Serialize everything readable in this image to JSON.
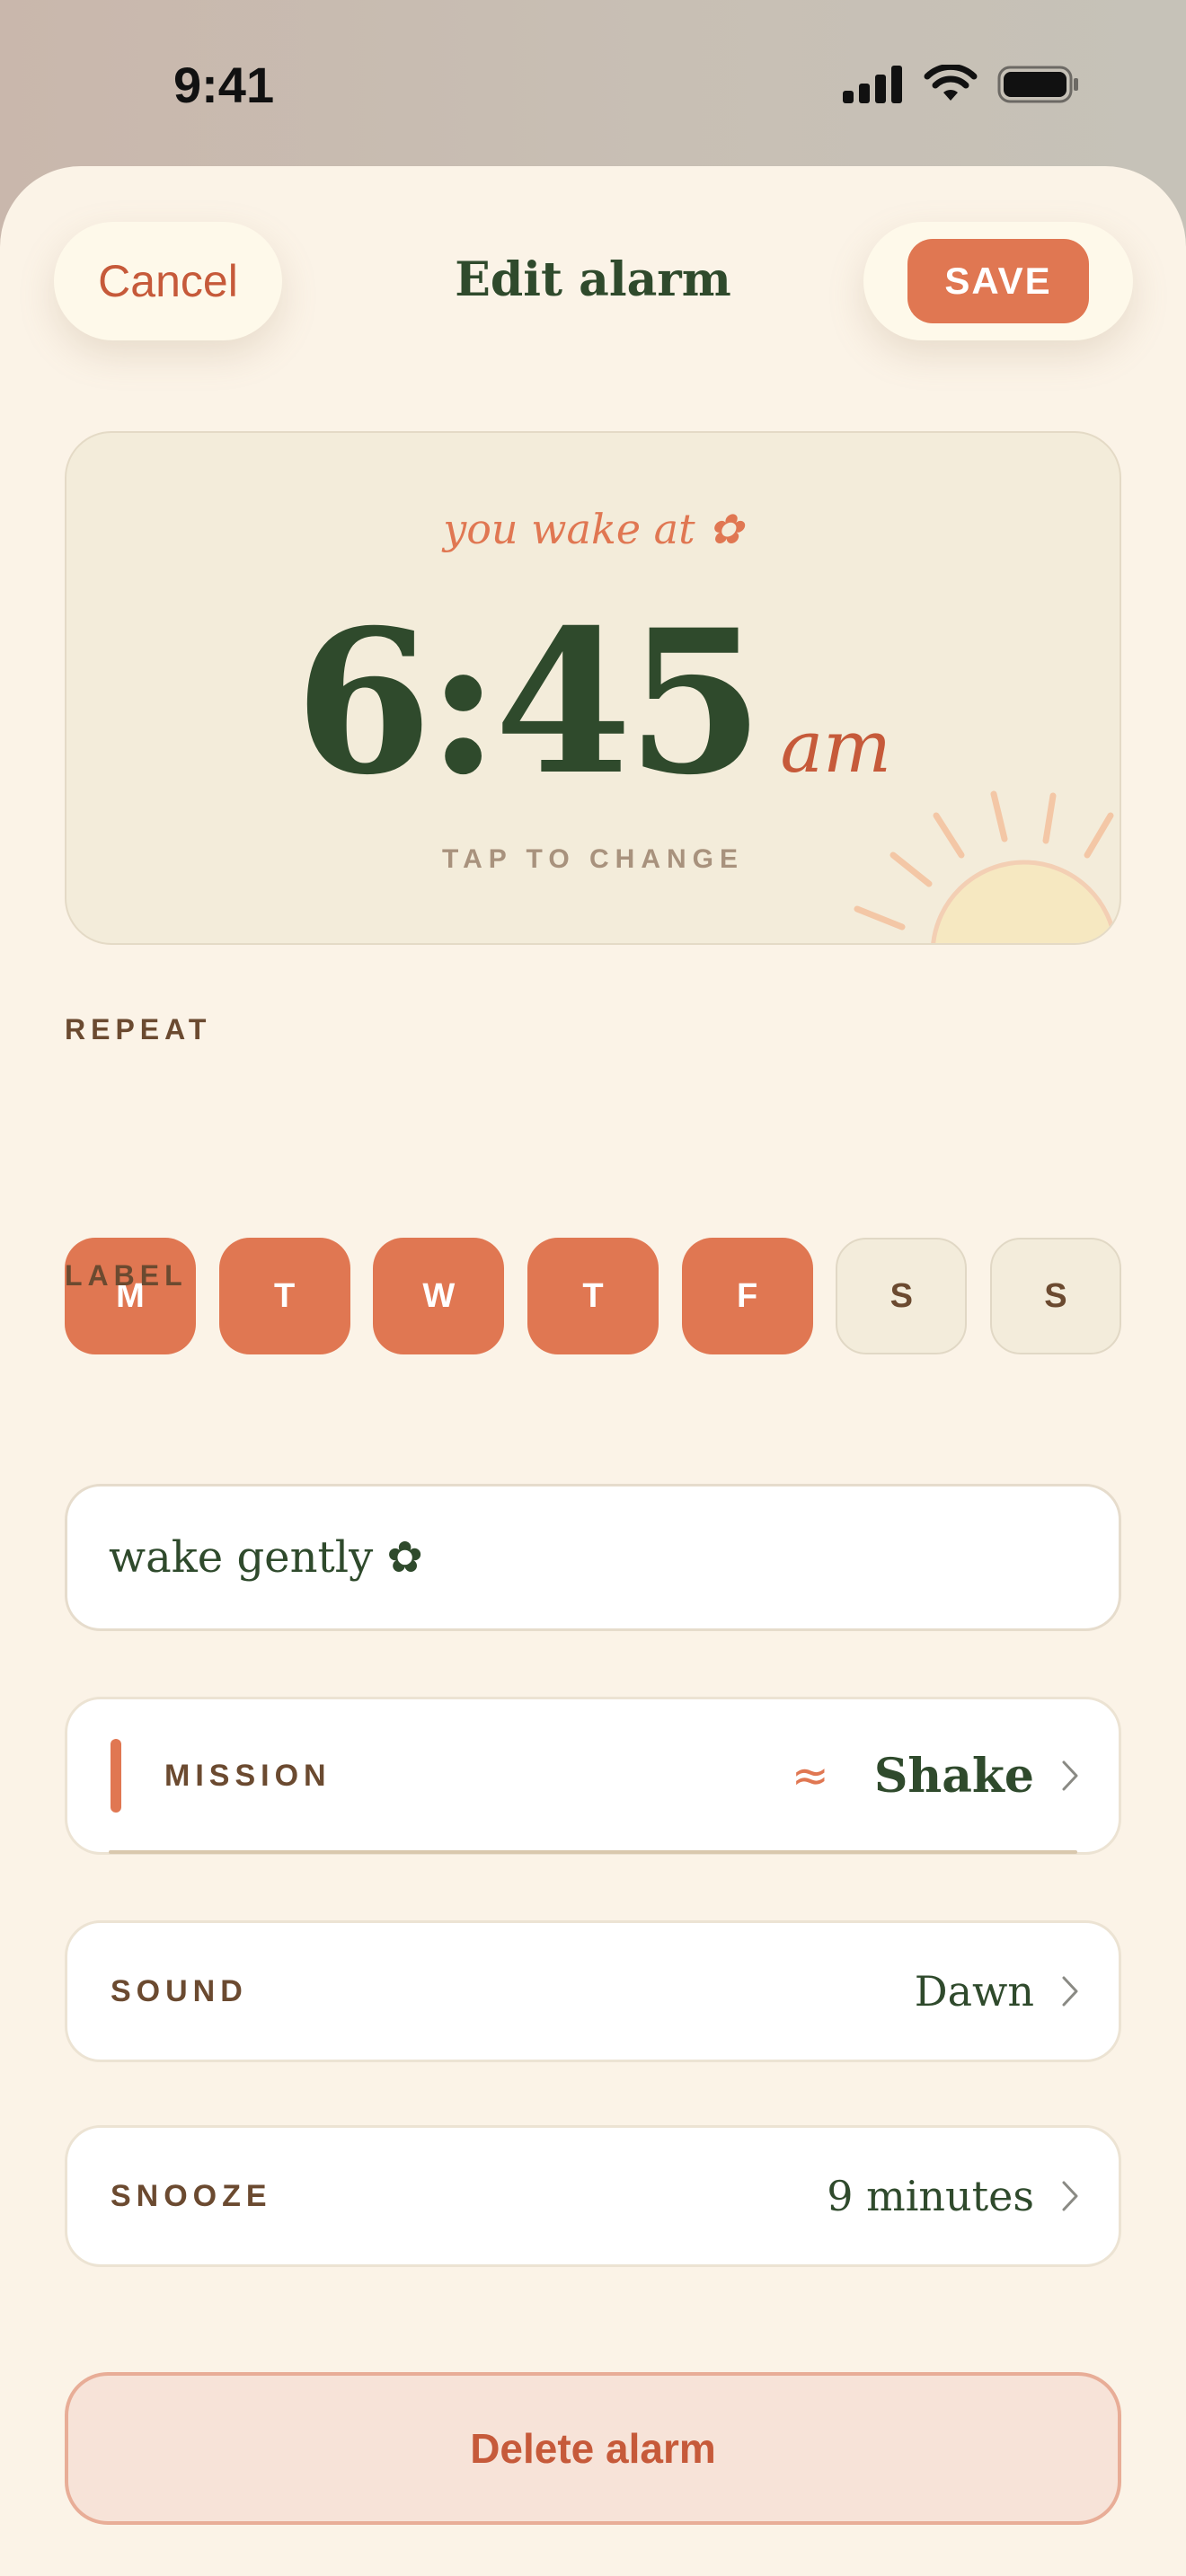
{
  "status_bar": {
    "time": "9:41",
    "icons": [
      "cellular-signal-icon",
      "wifi-icon",
      "battery-icon"
    ]
  },
  "nav": {
    "cancel_label": "Cancel",
    "title": "Edit alarm",
    "save_label": "SAVE"
  },
  "time_card": {
    "caption": "you wake at ✿",
    "time": "6:45",
    "ampm": "am",
    "hint": "TAP TO CHANGE",
    "decoration": "sun-icon"
  },
  "repeat": {
    "label": "REPEAT",
    "days": [
      {
        "letter": "M",
        "selected": true
      },
      {
        "letter": "T",
        "selected": true
      },
      {
        "letter": "W",
        "selected": true
      },
      {
        "letter": "T",
        "selected": true
      },
      {
        "letter": "F",
        "selected": true
      },
      {
        "letter": "S",
        "selected": false
      },
      {
        "letter": "S",
        "selected": false
      }
    ]
  },
  "label_field": {
    "label": "LABEL",
    "value": "wake gently ✿"
  },
  "mission": {
    "label": "MISSION",
    "icon_glyph": "≈",
    "value": "Shake"
  },
  "sound": {
    "label": "SOUND",
    "value": "Dawn"
  },
  "snooze": {
    "label": "SNOOZE",
    "value": "9 minutes"
  },
  "delete_label": "Delete alarm",
  "colors": {
    "accent": "#e07752",
    "accent_dark": "#c65a3a",
    "forest": "#2f4a2c",
    "brown": "#6b4a30",
    "background": "#fbf3e7"
  }
}
